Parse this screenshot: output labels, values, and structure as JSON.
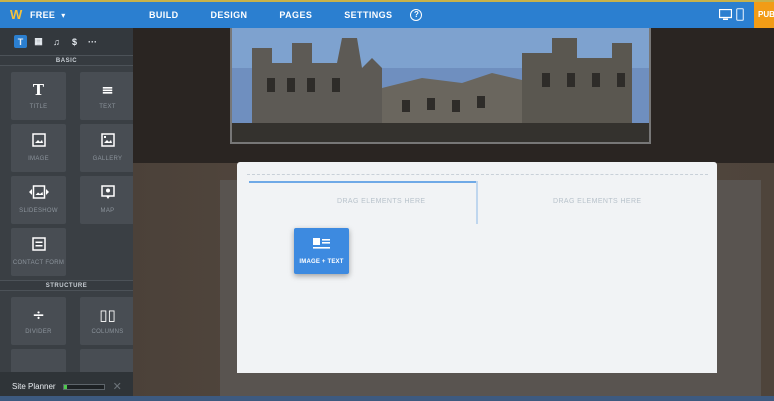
{
  "topbar": {
    "plan_label": "FREE",
    "tabs": [
      {
        "label": "BUILD"
      },
      {
        "label": "DESIGN"
      },
      {
        "label": "PAGES"
      },
      {
        "label": "SETTINGS"
      }
    ],
    "help_label": "?",
    "publish_label": "PUB",
    "colors": {
      "bar": "#2b7fd0",
      "publish": "#f29c16",
      "logo": "#f6c23a"
    }
  },
  "sidebar": {
    "categories": [
      {
        "label": "T",
        "icon": "text-category-icon",
        "active": true
      },
      {
        "label": "▦",
        "icon": "layout-category-icon"
      },
      {
        "label": "♫",
        "icon": "media-category-icon"
      },
      {
        "label": "$",
        "icon": "commerce-category-icon"
      },
      {
        "label": "···",
        "icon": "more-category-icon"
      }
    ],
    "basic_heading": "BASIC",
    "basic_items": [
      {
        "label": "TITLE",
        "icon": "T"
      },
      {
        "label": "TEXT",
        "icon": "≡"
      },
      {
        "label": "IMAGE",
        "icon": "▣"
      },
      {
        "label": "GALLERY",
        "icon": "▣"
      },
      {
        "label": "SLIDESHOW",
        "icon": "◂▣▸"
      },
      {
        "label": "MAP",
        "icon": "⌖"
      },
      {
        "label": "CONTACT FORM",
        "icon": "☰"
      }
    ],
    "structure_heading": "STRUCTURE",
    "structure_items": [
      {
        "label": "DIVIDER",
        "icon": "÷"
      },
      {
        "label": "COLUMNS",
        "icon": "▯▯"
      }
    ],
    "site_planner": {
      "label": "Site Planner",
      "progress": 0.08,
      "close": "✕"
    }
  },
  "canvas": {
    "drop_left": "DRAG ELEMENTS HERE",
    "drop_right": "DRAG ELEMENTS HERE",
    "dragging_element": {
      "label": "IMAGE + TEXT",
      "icon": "image-text-icon"
    }
  }
}
